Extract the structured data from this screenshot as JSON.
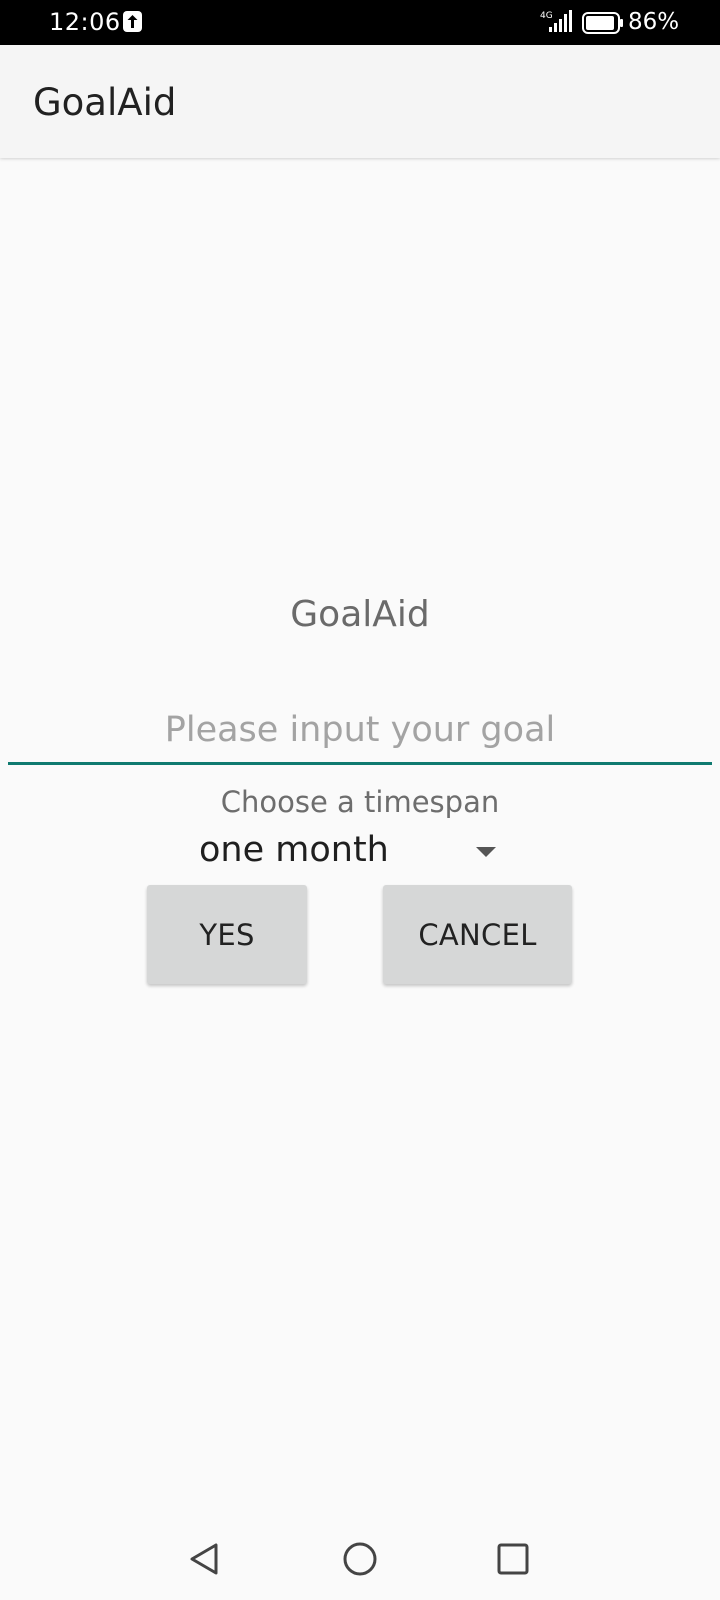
{
  "status_bar": {
    "time": "12:06",
    "network": "4G",
    "battery": "86%",
    "icons": [
      "upload-icon",
      "signal-icon",
      "battery-icon"
    ]
  },
  "app_bar": {
    "title": "GoalAid"
  },
  "form": {
    "title": "GoalAid",
    "goal_placeholder": "Please input your goal",
    "goal_value": "",
    "timespan_label": "Choose a timespan",
    "timespan_selected": "one month"
  },
  "buttons": {
    "yes_label": "YES",
    "cancel_label": "CANCEL"
  },
  "nav_bar": {
    "icons": [
      "back-icon",
      "home-icon",
      "recents-icon"
    ]
  },
  "colors": {
    "accent": "#0f7a70",
    "button_bg": "#d6d7d7",
    "app_bar_bg": "#f5f5f5",
    "background": "#fafafa"
  }
}
